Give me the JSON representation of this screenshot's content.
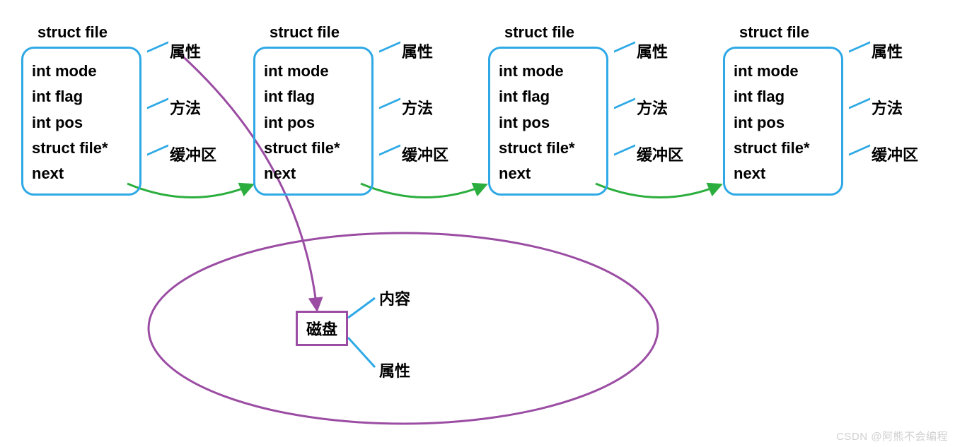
{
  "node": {
    "title": "struct file",
    "fields": [
      "int mode",
      "int flag",
      "int pos",
      "struct file* next"
    ],
    "tags": [
      "属性",
      "方法",
      "缓冲区"
    ]
  },
  "disk": {
    "label": "磁盘",
    "content": "内容",
    "attr": "属性"
  },
  "watermark": "CSDN @阿熊不会编程"
}
